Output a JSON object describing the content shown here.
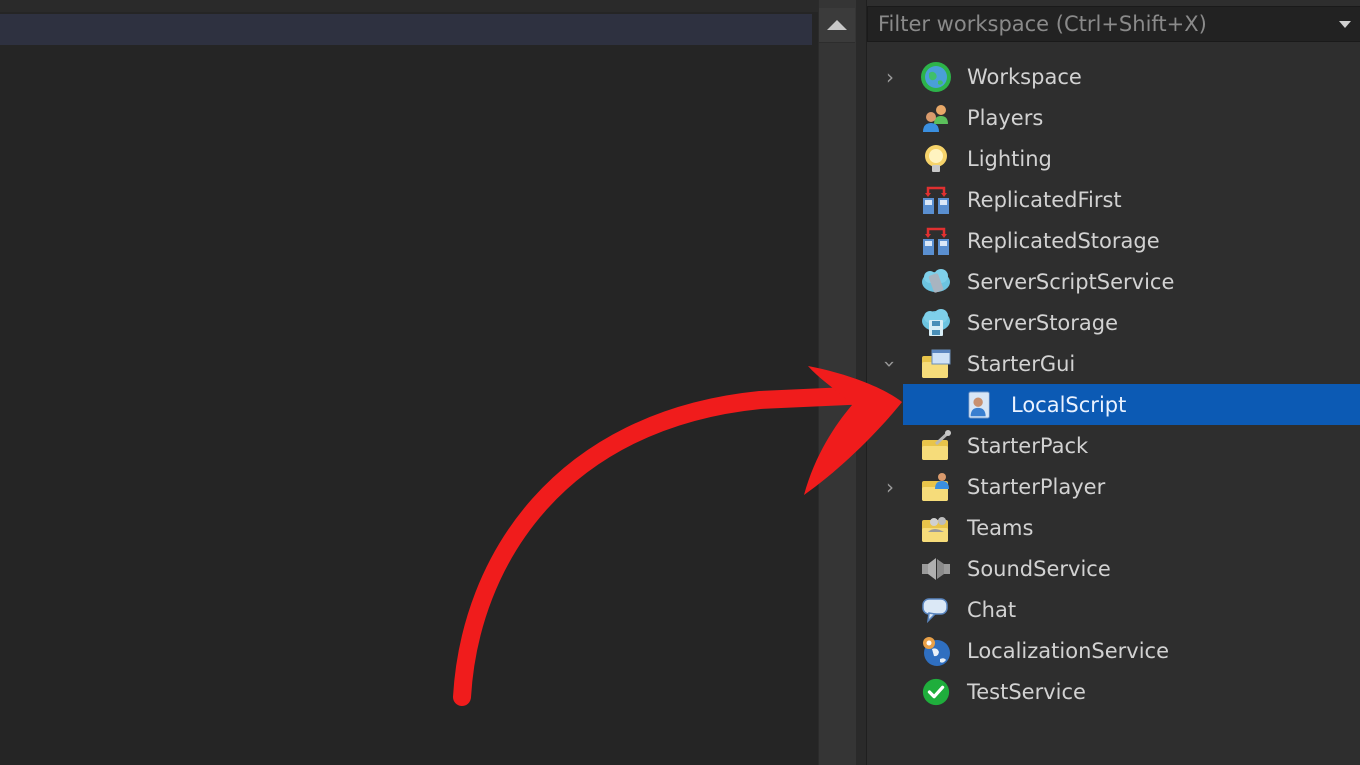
{
  "editor": {
    "scroll_up_label": "▲"
  },
  "explorer": {
    "filter_placeholder": "Filter workspace (Ctrl+Shift+X)",
    "filter_value": "",
    "items": [
      {
        "label": "Workspace",
        "icon": "workspace-globe-icon",
        "expander": "collapsed",
        "depth": 0,
        "selected": false
      },
      {
        "label": "Players",
        "icon": "players-icon",
        "expander": "none",
        "depth": 0,
        "selected": false
      },
      {
        "label": "Lighting",
        "icon": "lightbulb-icon",
        "expander": "none",
        "depth": 0,
        "selected": false
      },
      {
        "label": "ReplicatedFirst",
        "icon": "replicated-first-icon",
        "expander": "none",
        "depth": 0,
        "selected": false
      },
      {
        "label": "ReplicatedStorage",
        "icon": "replicated-storage-icon",
        "expander": "none",
        "depth": 0,
        "selected": false
      },
      {
        "label": "ServerScriptService",
        "icon": "server-script-service-icon",
        "expander": "none",
        "depth": 0,
        "selected": false
      },
      {
        "label": "ServerStorage",
        "icon": "server-storage-icon",
        "expander": "none",
        "depth": 0,
        "selected": false
      },
      {
        "label": "StarterGui",
        "icon": "starter-gui-folder-icon",
        "expander": "expanded",
        "depth": 0,
        "selected": false
      },
      {
        "label": "LocalScript",
        "icon": "local-script-icon",
        "expander": "none",
        "depth": 1,
        "selected": true
      },
      {
        "label": "StarterPack",
        "icon": "starter-pack-folder-icon",
        "expander": "none",
        "depth": 0,
        "selected": false
      },
      {
        "label": "StarterPlayer",
        "icon": "starter-player-folder-icon",
        "expander": "collapsed",
        "depth": 0,
        "selected": false
      },
      {
        "label": "Teams",
        "icon": "teams-folder-icon",
        "expander": "none",
        "depth": 0,
        "selected": false
      },
      {
        "label": "SoundService",
        "icon": "speaker-icon",
        "expander": "none",
        "depth": 0,
        "selected": false
      },
      {
        "label": "Chat",
        "icon": "chat-bubble-icon",
        "expander": "none",
        "depth": 0,
        "selected": false
      },
      {
        "label": "LocalizationService",
        "icon": "localization-globe-icon",
        "expander": "none",
        "depth": 0,
        "selected": false
      },
      {
        "label": "TestService",
        "icon": "checkmark-icon",
        "expander": "none",
        "depth": 0,
        "selected": false
      }
    ]
  },
  "annotation": {
    "type": "red-curved-arrow",
    "points_to": "LocalScript",
    "color": "#f01c1c"
  },
  "colors": {
    "selection": "#0c5ab4",
    "panel_bg": "#2e2e2e",
    "editor_bg": "#252525"
  }
}
